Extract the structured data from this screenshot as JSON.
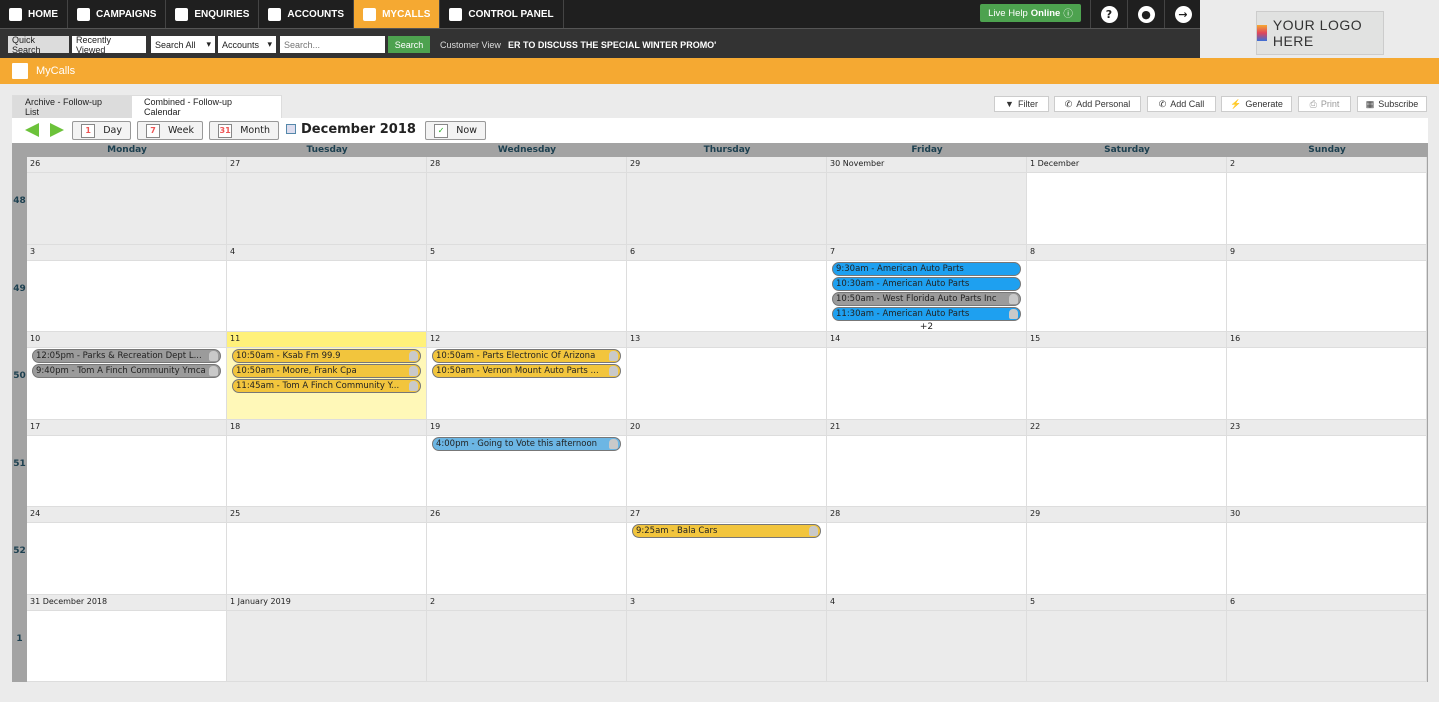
{
  "nav": {
    "items": [
      {
        "label": "HOME",
        "icon": "home-icon"
      },
      {
        "label": "CAMPAIGNS",
        "icon": "campaigns-icon"
      },
      {
        "label": "ENQUIRIES",
        "icon": "enquiries-icon"
      },
      {
        "label": "ACCOUNTS",
        "icon": "bank-icon"
      },
      {
        "label": "MYCALLS",
        "icon": "checklist-icon",
        "active": true
      },
      {
        "label": "CONTROL PANEL",
        "icon": "control-panel-icon"
      }
    ],
    "live_help_prefix": "Live Help",
    "live_help_status": "Online",
    "help": "?",
    "accent": "#f5a932"
  },
  "subbar": {
    "quick_search": "Quick Search",
    "recently_viewed": "Recently Viewed",
    "search_scope": "Search All",
    "search_type": "Accounts",
    "search_placeholder": "Search...",
    "search_button": "Search",
    "customer_view": "Customer View",
    "ticker": "ER TO DISCUSS THE SPECIAL WINTER PROMO'"
  },
  "logo": {
    "text": "YOUR LOGO HERE"
  },
  "page": {
    "title": "MyCalls"
  },
  "tabs": [
    {
      "label": "Archive - Follow-up List"
    },
    {
      "label": "Combined - Follow-up Calendar",
      "active": true
    }
  ],
  "actions": {
    "filter": "Filter",
    "add_personal": "Add Personal",
    "add_call": "Add Call",
    "generate": "Generate",
    "print": "Print",
    "subscribe": "Subscribe"
  },
  "calendar": {
    "day": "Day",
    "week": "Week",
    "month": "Month",
    "now": "Now",
    "title": "December 2018",
    "days": [
      "Monday",
      "Tuesday",
      "Wednesday",
      "Thursday",
      "Friday",
      "Saturday",
      "Sunday"
    ],
    "weeks": [
      {
        "number": "48",
        "dates": [
          "26",
          "27",
          "28",
          "29",
          "30 November",
          "1 December",
          "2"
        ],
        "out": [
          true,
          true,
          true,
          true,
          true,
          false,
          false
        ]
      },
      {
        "number": "49",
        "dates": [
          "3",
          "4",
          "5",
          "6",
          "7",
          "8",
          "9"
        ]
      },
      {
        "number": "50",
        "dates": [
          "10",
          "11",
          "12",
          "13",
          "14",
          "15",
          "16"
        ],
        "today": 1
      },
      {
        "number": "51",
        "dates": [
          "17",
          "18",
          "19",
          "20",
          "21",
          "22",
          "23"
        ]
      },
      {
        "number": "52",
        "dates": [
          "24",
          "25",
          "26",
          "27",
          "28",
          "29",
          "30"
        ]
      },
      {
        "number": "1",
        "dates": [
          "31 December 2018",
          "1 January 2019",
          "2",
          "3",
          "4",
          "5",
          "6"
        ],
        "out": [
          false,
          true,
          true,
          true,
          true,
          true,
          true
        ]
      }
    ],
    "events": [
      {
        "week": 1,
        "day": 4,
        "text": "9:30am - American Auto Parts",
        "color": "#1ea0f0"
      },
      {
        "week": 1,
        "day": 4,
        "text": "10:30am - American Auto Parts",
        "color": "#1ea0f0"
      },
      {
        "week": 1,
        "day": 4,
        "text": "10:50am - West Florida Auto Parts Inc",
        "color": "#9b9b9b",
        "person": true
      },
      {
        "week": 1,
        "day": 4,
        "text": "11:30am - American Auto Parts",
        "color": "#1ea0f0",
        "person": true
      },
      {
        "week": 2,
        "day": 0,
        "text": "12:05pm - Parks & Recreation Dept L...",
        "color": "#9b9b9b",
        "person": true
      },
      {
        "week": 2,
        "day": 0,
        "text": "9:40pm - Tom A Finch Community Ymca",
        "color": "#9b9b9b",
        "person": true
      },
      {
        "week": 2,
        "day": 1,
        "text": "10:50am - Ksab Fm 99.9",
        "color": "#f2c53d",
        "person": true
      },
      {
        "week": 2,
        "day": 1,
        "text": "10:50am - Moore, Frank Cpa",
        "color": "#f2c53d",
        "person": true
      },
      {
        "week": 2,
        "day": 1,
        "text": "11:45am - Tom A Finch Community Y...",
        "color": "#f2c53d",
        "person": true
      },
      {
        "week": 2,
        "day": 2,
        "text": "10:50am - Parts Electronic Of Arizona",
        "color": "#f2c53d",
        "person": true
      },
      {
        "week": 2,
        "day": 2,
        "text": "10:50am - Vernon Mount Auto Parts ...",
        "color": "#f2c53d",
        "person": true
      },
      {
        "week": 3,
        "day": 2,
        "text": "4:00pm - Going to Vote this afternoon",
        "color": "#6cb6e4",
        "person": true
      },
      {
        "week": 4,
        "day": 3,
        "text": "9:25am - Bala Cars",
        "color": "#f2c53d",
        "person": true
      }
    ],
    "more": [
      {
        "week": 1,
        "day": 4,
        "text": "+2"
      }
    ]
  }
}
